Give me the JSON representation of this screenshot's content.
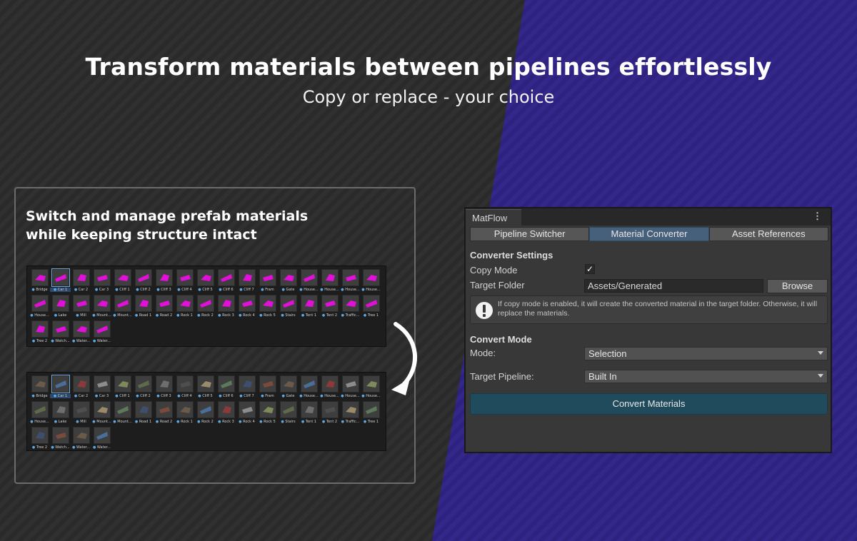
{
  "hero": {
    "title": "Transform materials between pipelines effortlessly",
    "subtitle": "Copy or replace - your choice"
  },
  "left_card": {
    "title_line1": "Switch and manage prefab materials",
    "title_line2": "while keeping structure intact"
  },
  "assets": [
    {
      "label": "Bridge"
    },
    {
      "label": "Car 1",
      "selected": true
    },
    {
      "label": "Car 2"
    },
    {
      "label": "Car 3"
    },
    {
      "label": "Cliff 1"
    },
    {
      "label": "Cliff 2"
    },
    {
      "label": "Cliff 3"
    },
    {
      "label": "Cliff 4"
    },
    {
      "label": "Cliff 5"
    },
    {
      "label": "Cliff 6"
    },
    {
      "label": "Cliff 7"
    },
    {
      "label": "Fram"
    },
    {
      "label": "Gate"
    },
    {
      "label": "House..."
    },
    {
      "label": "House..."
    },
    {
      "label": "House..."
    },
    {
      "label": "House..."
    },
    {
      "label": "House..."
    },
    {
      "label": "Lake"
    },
    {
      "label": "Mill"
    },
    {
      "label": "Mount..."
    },
    {
      "label": "Mount..."
    },
    {
      "label": "Road 1"
    },
    {
      "label": "Road 2"
    },
    {
      "label": "Rock 1"
    },
    {
      "label": "Rock 2"
    },
    {
      "label": "Rock 3"
    },
    {
      "label": "Rock 4"
    },
    {
      "label": "Rock 5"
    },
    {
      "label": "Stairs"
    },
    {
      "label": "Tent 1"
    },
    {
      "label": "Tent 2"
    },
    {
      "label": "Traffic..."
    },
    {
      "label": "Tree 1"
    },
    {
      "label": "Tree 2"
    },
    {
      "label": "Watch..."
    },
    {
      "label": "Water..."
    },
    {
      "label": "Water..."
    }
  ],
  "colors": {
    "broken_material": "#e010d8",
    "bg_dark": "#303030",
    "bg_purple": "#34278a",
    "asset_icon_blue": "#5aa9e6"
  },
  "window": {
    "tab_title": "MatFlow",
    "menu_icon": "kebab-menu-icon",
    "toolbar": [
      "Pipeline Switcher",
      "Material Converter",
      "Asset References"
    ],
    "active_toolbar_index": 1,
    "converter_settings_header": "Converter Settings",
    "copy_mode_label": "Copy Mode",
    "copy_mode_checked": true,
    "target_folder_label": "Target Folder",
    "target_folder_value": "Assets/Generated",
    "browse_label": "Browse",
    "help_text": "If copy mode is enabled, it will create the converted material in the target folder. Otherwise, it will replace the materials.",
    "convert_mode_header": "Convert Mode",
    "mode_label": "Mode:",
    "mode_value": "Selection",
    "target_pipeline_label": "Target Pipeline:",
    "target_pipeline_value": "Built In",
    "convert_button": "Convert Materials"
  }
}
